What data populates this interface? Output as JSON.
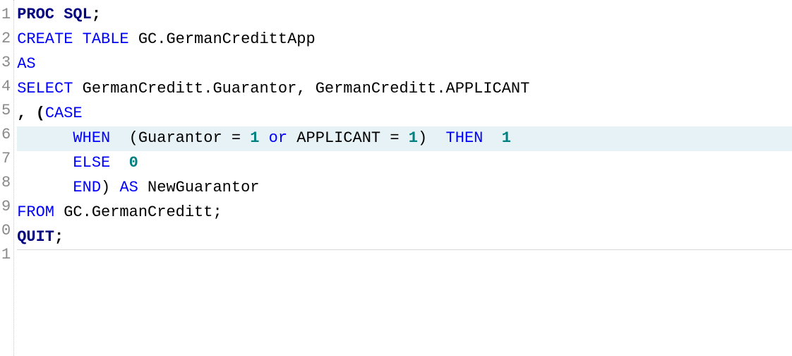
{
  "gutter": [
    "1",
    "2",
    "3",
    "4",
    "5",
    "6",
    "7",
    "8",
    "9",
    "0",
    "1"
  ],
  "code": {
    "l1": {
      "proc": "PROC",
      "sql": "SQL",
      "semi": ";"
    },
    "l2": {
      "create": "CREATE",
      "table": "TABLE",
      "name": "GC.GermanCredittApp"
    },
    "l3": {
      "as": "AS"
    },
    "l4": {
      "select": "SELECT",
      "col1": "GermanCreditt.Guarantor",
      "comma": ", ",
      "col2": "GermanCreditt.APPLICANT"
    },
    "l5": {
      "lead": ", (",
      "case": "CASE"
    },
    "l6": {
      "indent": "      ",
      "when": "WHEN",
      "sp": "  ",
      "open": "(",
      "g": "Guarantor ",
      "eq1": "= ",
      "n1": "1",
      "or": " or ",
      "a": "APPLICANT ",
      "eq2": "= ",
      "n2": "1",
      "close": ")",
      "sp2": "  ",
      "then": "THEN",
      "sp3": "  ",
      "n3": "1"
    },
    "l7": {
      "indent": "      ",
      "else": "ELSE",
      "sp": "  ",
      "n": "0"
    },
    "l8": {
      "indent": "      ",
      "end": "END",
      "close": ") ",
      "as": "AS",
      "name": " NewGuarantor"
    },
    "l9": {
      "from": "FROM",
      "tbl": " GC.GermanCreditt",
      "semi": ";"
    },
    "l10": {
      "quit": "QUIT",
      "semi": ";"
    }
  }
}
